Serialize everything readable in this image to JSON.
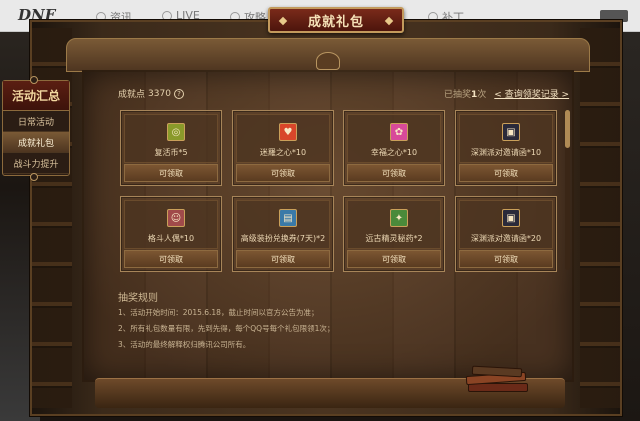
{
  "site": {
    "logo": "DNF",
    "nav": [
      "资讯",
      "LIVE",
      "攻略",
      "补丁"
    ],
    "corner": "DNF"
  },
  "popup": {
    "title": "成就礼包"
  },
  "side_menu": {
    "heading": "活动汇总",
    "items": [
      {
        "label": "日常活动",
        "active": false
      },
      {
        "label": "成就礼包",
        "active": true
      },
      {
        "label": "战斗力提升",
        "active": false
      }
    ]
  },
  "info": {
    "points_label": "成就点",
    "points_value": "3370",
    "help_icon": "?",
    "draw_prefix": "已抽奖",
    "draw_count": "1",
    "draw_suffix": "次",
    "record_link": "< 查询领奖记录 >"
  },
  "rewards": [
    {
      "name": "复活币*5",
      "button": "可领取",
      "icon": "coin-icon",
      "color": "#8a9a2a"
    },
    {
      "name": "迷羅之心*10",
      "button": "可领取",
      "icon": "heart-icon",
      "color": "#d8462a"
    },
    {
      "name": "幸福之心*10",
      "button": "可领取",
      "icon": "pink-heart-icon",
      "color": "#d84a9a"
    },
    {
      "name": "深渊派对邀请函*10",
      "button": "可领取",
      "icon": "invitation-icon",
      "color": "#2a2a3a"
    },
    {
      "name": "格斗人偶*10",
      "button": "可领取",
      "icon": "puppet-icon",
      "color": "#a04a4a"
    },
    {
      "name": "高级装扮兑换券(7天)*2",
      "button": "可领取",
      "icon": "ticket-icon",
      "color": "#3a7aa8"
    },
    {
      "name": "远古精灵秘药*2",
      "button": "可领取",
      "icon": "potion-icon",
      "color": "#4a8a3a"
    },
    {
      "name": "深渊派对邀请函*20",
      "button": "可领取",
      "icon": "invitation-icon",
      "color": "#2a2a3a"
    }
  ],
  "rules": {
    "title": "抽奖规则",
    "lines": [
      "1、活动开始时间：2015.6.18，截止时间以官方公告为准；",
      "2、所有礼包数量有限，先到先得，每个QQ号每个礼包限领1次；",
      "3、活动的最终解释权归腾讯公司所有。"
    ]
  }
}
